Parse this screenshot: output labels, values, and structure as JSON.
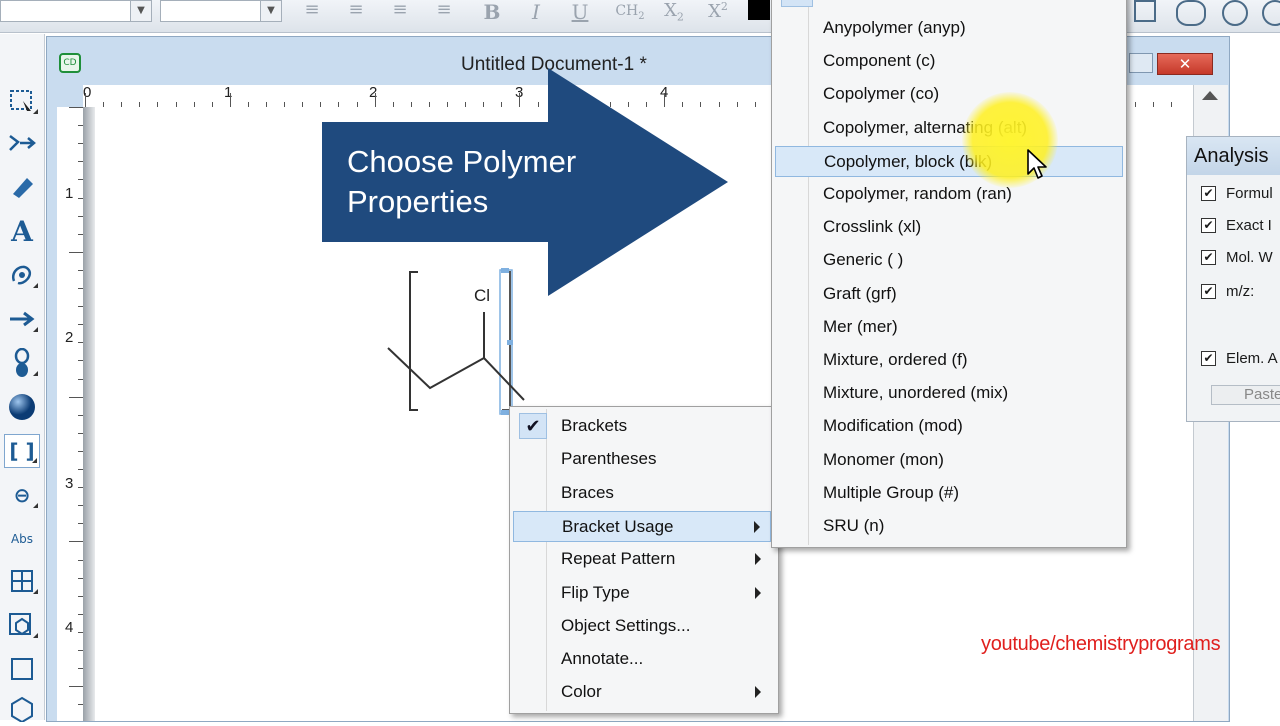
{
  "document": {
    "title": "Untitled Document-1 *",
    "ruler_h": [
      "0",
      "1",
      "2",
      "3",
      "4"
    ],
    "ruler_v": [
      "1",
      "2",
      "3",
      "4"
    ]
  },
  "callout": {
    "line1": "Choose Polymer",
    "line2": "Properties",
    "color": "#1f4a7e"
  },
  "molecule": {
    "atom_label": "Cl"
  },
  "context_menu": {
    "items": [
      {
        "label": "Brackets",
        "checked": true
      },
      {
        "label": "Parentheses"
      },
      {
        "label": "Braces"
      },
      {
        "label": "Bracket Usage",
        "has_submenu": true,
        "highlighted": true
      },
      {
        "label": "Repeat Pattern",
        "has_submenu": true
      },
      {
        "label": "Flip Type",
        "has_submenu": true
      },
      {
        "label": "Object Settings..."
      },
      {
        "label": "Annotate..."
      },
      {
        "label": "Color",
        "has_submenu": true
      }
    ]
  },
  "bracket_usage_menu": {
    "items": [
      {
        "label": "Anypolymer (anyp)"
      },
      {
        "label": "Component (c)"
      },
      {
        "label": "Copolymer (co)"
      },
      {
        "label": "Copolymer, alternating (alt)"
      },
      {
        "label": "Copolymer, block (blk)",
        "highlighted": true
      },
      {
        "label": "Copolymer, random (ran)"
      },
      {
        "label": "Crosslink (xl)"
      },
      {
        "label": "Generic ( )"
      },
      {
        "label": "Graft (grf)"
      },
      {
        "label": "Mer (mer)"
      },
      {
        "label": "Mixture, ordered (f)"
      },
      {
        "label": "Mixture, unordered (mix)"
      },
      {
        "label": "Modification (mod)"
      },
      {
        "label": "Monomer (mon)"
      },
      {
        "label": "Multiple Group (#)"
      },
      {
        "label": "SRU (n)"
      }
    ]
  },
  "analysis_panel": {
    "title": "Analysis",
    "rows": [
      {
        "label": "Formul",
        "checked": true
      },
      {
        "label": "Exact I",
        "checked": true
      },
      {
        "label": "Mol. W",
        "checked": true
      },
      {
        "label": "m/z:",
        "checked": true
      },
      {
        "label": "Elem. A",
        "checked": true
      }
    ],
    "paste_label": "Paste"
  },
  "toolbar": {
    "bold": "B",
    "italic": "I",
    "underline": "U",
    "ch2": "CH",
    "ch2_sub": "2",
    "subscript": "X",
    "subscript_sub": "2",
    "superscript": "X",
    "superscript_sup": "2"
  },
  "palette": {
    "text_tool": "A",
    "abs_tool": "Abs"
  },
  "watermark": "youtube/chemistryprograms"
}
